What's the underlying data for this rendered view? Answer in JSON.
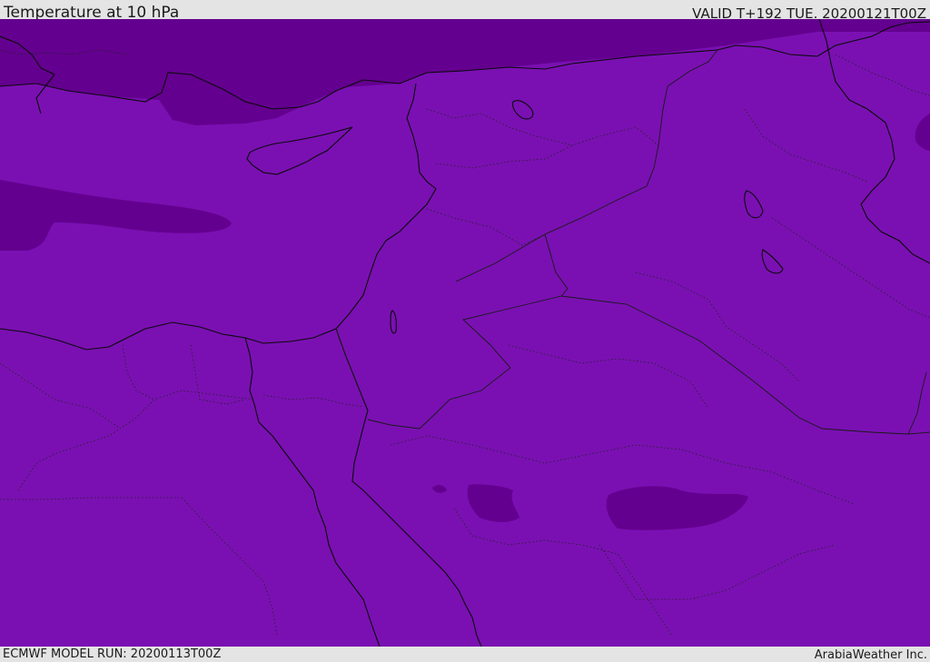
{
  "header": {
    "title": "Temperature at 10 hPa",
    "valid_time": "VALID T+192 TUE. 20200121T00Z"
  },
  "footer": {
    "model_run": "ECMWF MODEL RUN: 20200113T00Z",
    "credit": "ArabiaWeather Inc."
  },
  "map": {
    "fill_colors": {
      "base": "#7a10b2",
      "dark": "#64008f"
    },
    "line_colors": {
      "coastline": "#0a0a0a",
      "border": "#1a1a1a"
    }
  }
}
